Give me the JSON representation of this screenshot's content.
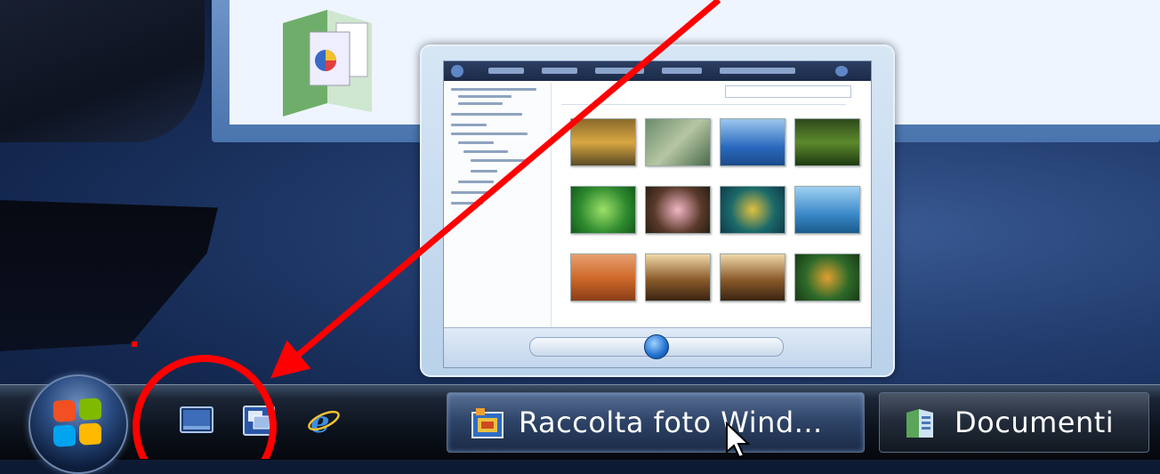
{
  "taskbar": {
    "buttons": [
      {
        "label": "Raccolta foto Wind...",
        "icon": "photo-gallery-icon",
        "active": true
      },
      {
        "label": "Documenti",
        "icon": "documents-folder-icon",
        "active": false
      }
    ],
    "quick_launch": [
      {
        "icon": "show-desktop-icon"
      },
      {
        "icon": "switch-windows-icon"
      },
      {
        "icon": "internet-explorer-icon"
      }
    ]
  },
  "annotation": {
    "arrow_color": "#ff0000",
    "circle_color": "#ff0000"
  },
  "colors": {
    "taskbar": "#0c121c",
    "desktop": "#233e70",
    "accent": "#1e6fcf"
  }
}
